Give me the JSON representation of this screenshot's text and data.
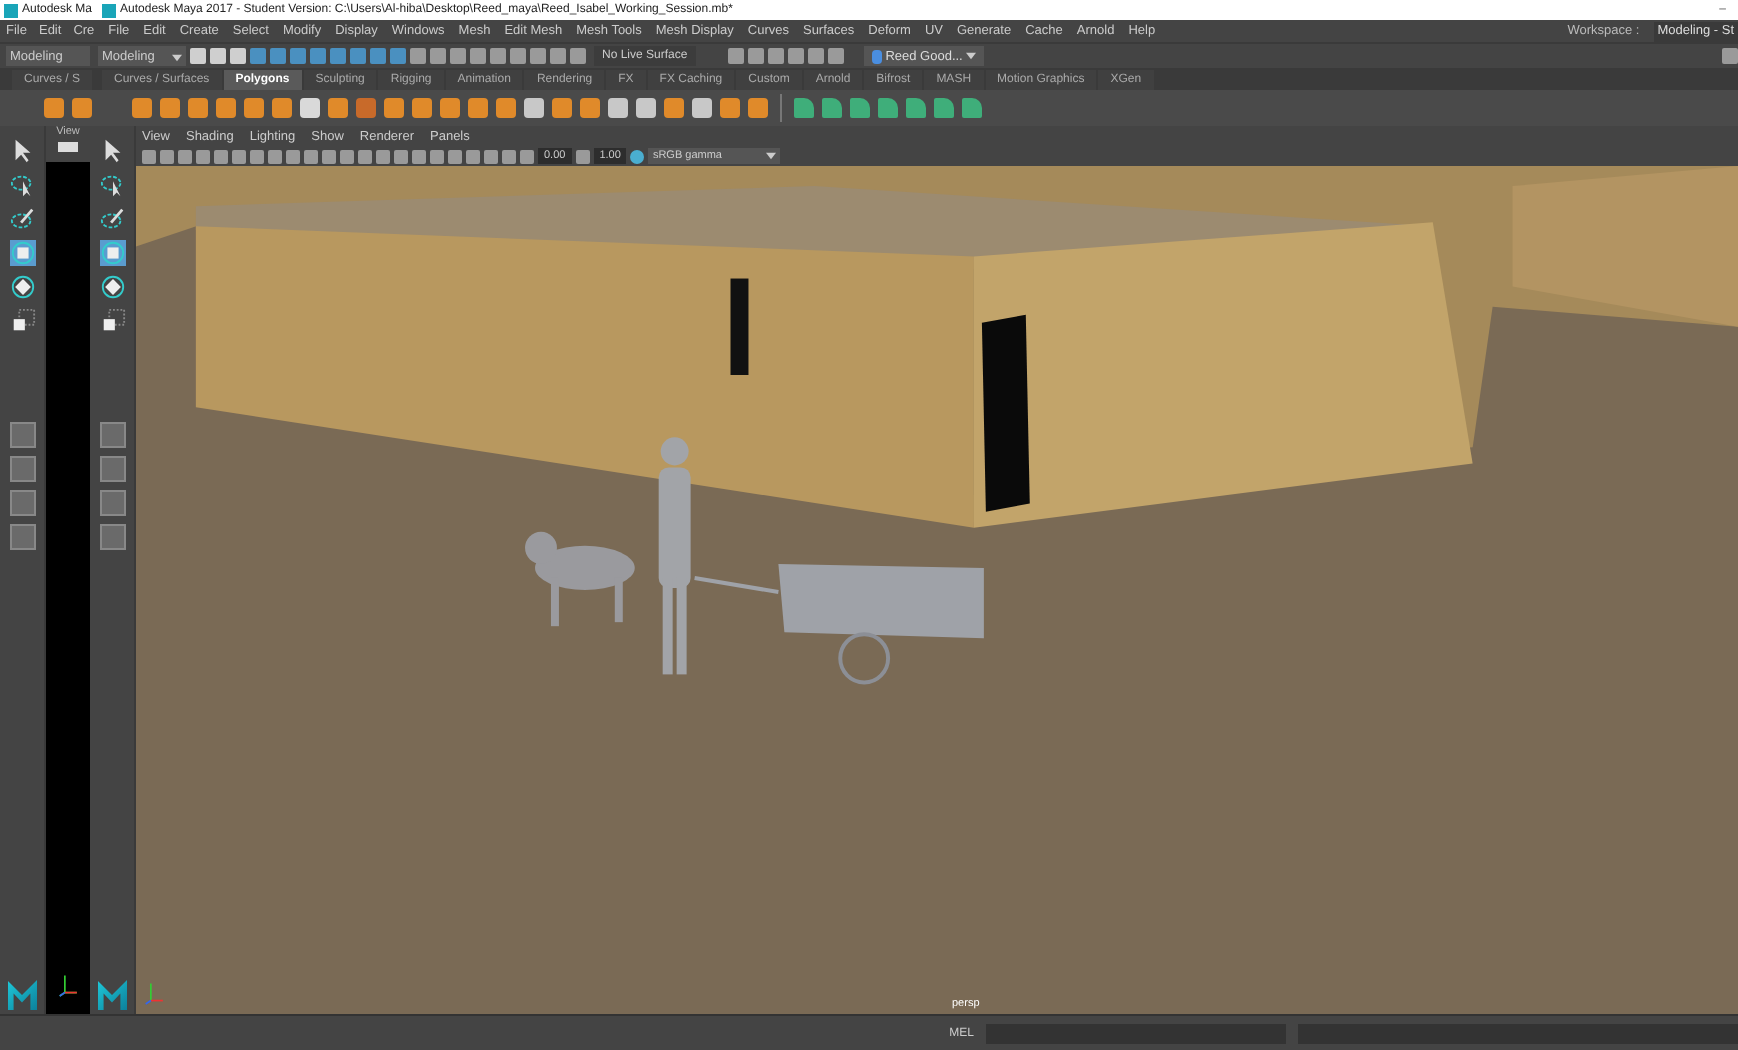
{
  "title_bar": {
    "background_window_title": "Autodesk Ma",
    "title": "Autodesk Maya 2017 - Student Version: C:\\Users\\Al-hiba\\Desktop\\Reed_maya\\Reed_Isabel_Working_Session.mb*",
    "minimize": "–"
  },
  "background_menu": [
    "File",
    "Edit",
    "Cre"
  ],
  "menu_bar": [
    "File",
    "Edit",
    "Create",
    "Select",
    "Modify",
    "Display",
    "Windows",
    "Mesh",
    "Edit Mesh",
    "Mesh Tools",
    "Mesh Display",
    "Curves",
    "Surfaces",
    "Deform",
    "UV",
    "Generate",
    "Cache",
    "Arnold",
    "Help"
  ],
  "workspace": {
    "label": "Workspace :",
    "value": "Modeling - St"
  },
  "status_line": {
    "background_mode": "Modeling",
    "mode": "Modeling",
    "live_surface": "No Live Surface",
    "account": "Reed Good..."
  },
  "background_shelf_tab": "Curves / S",
  "shelf_tabs": [
    {
      "label": "Curves / Surfaces",
      "selected": false
    },
    {
      "label": "Polygons",
      "selected": true
    },
    {
      "label": "Sculpting",
      "selected": false
    },
    {
      "label": "Rigging",
      "selected": false
    },
    {
      "label": "Animation",
      "selected": false
    },
    {
      "label": "Rendering",
      "selected": false
    },
    {
      "label": "FX",
      "selected": false
    },
    {
      "label": "FX Caching",
      "selected": false
    },
    {
      "label": "Custom",
      "selected": false
    },
    {
      "label": "Arnold",
      "selected": false
    },
    {
      "label": "Bifrost",
      "selected": false
    },
    {
      "label": "MASH",
      "selected": false
    },
    {
      "label": "Motion Graphics",
      "selected": false
    },
    {
      "label": "XGen",
      "selected": false
    }
  ],
  "background_toolbox": [
    {
      "kind": "select",
      "selected": false
    },
    {
      "kind": "lasso",
      "selected": false
    },
    {
      "kind": "paint",
      "selected": false
    },
    {
      "kind": "move",
      "selected": true
    },
    {
      "kind": "rotate",
      "selected": false
    },
    {
      "kind": "scale",
      "selected": false
    }
  ],
  "toolbox": [
    {
      "kind": "select",
      "selected": false
    },
    {
      "kind": "lasso",
      "selected": false
    },
    {
      "kind": "paint",
      "selected": false
    },
    {
      "kind": "move",
      "selected": true
    },
    {
      "kind": "rotate",
      "selected": false
    },
    {
      "kind": "scale",
      "selected": false
    }
  ],
  "side_panel": {
    "label": "View"
  },
  "viewport": {
    "menu": [
      "View",
      "Shading",
      "Lighting",
      "Show",
      "Renderer",
      "Panels"
    ],
    "exposure": "0.00",
    "gamma": "1.00",
    "color_space": "sRGB gamma",
    "camera": "persp"
  },
  "command_line": {
    "language": "MEL"
  }
}
